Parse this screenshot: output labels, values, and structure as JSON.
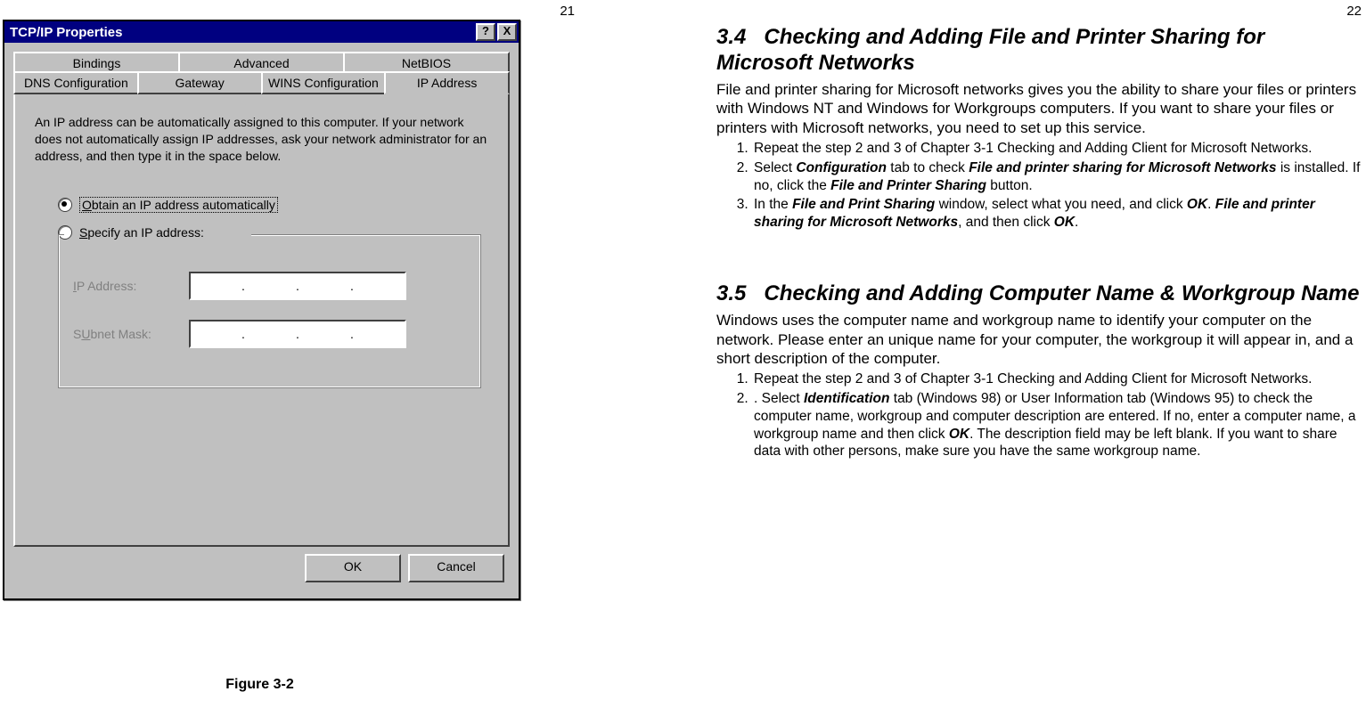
{
  "pages": {
    "left_num": "21",
    "right_num": "22"
  },
  "dialog": {
    "title": "TCP/IP Properties",
    "help_btn": "?",
    "close_btn": "X",
    "tabs_row_a": [
      "Bindings",
      "Advanced",
      "NetBIOS"
    ],
    "tabs_row_b": [
      "DNS Configuration",
      "Gateway",
      "WINS Configuration",
      "IP Address"
    ],
    "active_tab": "IP Address",
    "intro": "An IP address can be automatically assigned to this computer. If your network does not automatically assign IP addresses, ask your network administrator for an address, and then type it in the space below.",
    "radio_auto_prefix": "O",
    "radio_auto_rest": "btain an IP address automatically",
    "radio_specify_prefix": "S",
    "radio_specify_rest": "pecify an IP address:",
    "ip_label_prefix": "I",
    "ip_label_rest": "P Address:",
    "mask_label_prefix": "U",
    "mask_label": "Subnet Mask:",
    "dot": ".",
    "ok_btn": "OK",
    "cancel_btn": "Cancel"
  },
  "figure_caption": "Figure 3-2",
  "doc": {
    "s34_num": "3.4",
    "s34_title": "Checking and Adding File and Printer Sharing for Microsoft Networks",
    "s34_body": "File and printer sharing for Microsoft networks gives you the ability to share your files or printers with Windows NT and Windows for Workgroups computers. If you want to share your files or printers with Microsoft networks, you need to set up this service.",
    "s34_step1": "Repeat the step 2 and 3 of Chapter 3-1 Checking and Adding Client for Microsoft Networks.",
    "s34_step2_a": "Select ",
    "s34_step2_b": "Configuration",
    "s34_step2_c": " tab to check ",
    "s34_step2_d": "File and printer sharing for Microsoft Networks",
    "s34_step2_e": " is installed. If no, click the ",
    "s34_step2_f": "File and Printer Sharing",
    "s34_step2_g": " button.",
    "s34_step3_a": "In the ",
    "s34_step3_b": "File and Print Sharing",
    "s34_step3_c": " window, select what you need, and click ",
    "s34_step3_d": "OK",
    "s34_step3_e": ". ",
    "s34_step3_f": "File and printer sharing for Microsoft Networks",
    "s34_step3_g": ", and then click ",
    "s34_step3_h": "OK",
    "s34_step3_i": ".",
    "s35_num": "3.5",
    "s35_title": "Checking and Adding Computer Name & Workgroup Name",
    "s35_body": "Windows uses the computer name and workgroup name to identify your computer on the network. Please enter an unique name for your computer, the workgroup it will appear in, and a short description of the computer.",
    "s35_step1": "Repeat the step 2 and 3 of Chapter 3-1 Checking and Adding Client for Microsoft Networks.",
    "s35_step2_a": ". Select ",
    "s35_step2_b": "Identification",
    "s35_step2_c": " tab (Windows 98) or User Information tab (Windows 95) to check the computer name, workgroup and computer description are entered. If no, enter a computer name, a workgroup name and then click ",
    "s35_step2_d": "OK",
    "s35_step2_e": ". The description field may be left blank. If you want to share data with other persons, make sure you have the same workgroup name."
  }
}
